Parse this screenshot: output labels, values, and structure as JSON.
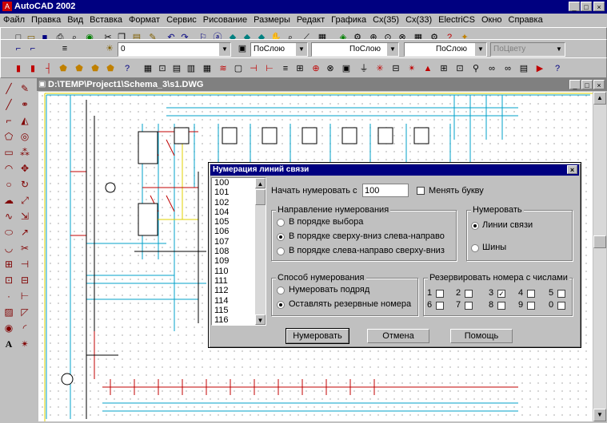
{
  "app": {
    "title": "AutoCAD 2002"
  },
  "menu": [
    "Файл",
    "Правка",
    "Вид",
    "Вставка",
    "Формат",
    "Сервис",
    "Рисование",
    "Размеры",
    "Редакт",
    "Графика",
    "Сх(35)",
    "Сх(33)",
    "ElectriCS",
    "Окно",
    "Справка"
  ],
  "toolbar2": {
    "layer": "0",
    "color": "ПоСлою",
    "linetype": "ПоСлою",
    "lineweight": "ПоСлою",
    "plotstyle": "ПоЦвету"
  },
  "drawing": {
    "title": "D:\\TEMP\\Project1\\Schema_3\\s1.DWG"
  },
  "dialog": {
    "title": "Нумерация линий связи",
    "list": [
      "100",
      "101",
      "102",
      "104",
      "105",
      "106",
      "107",
      "108",
      "109",
      "110",
      "111",
      "112",
      "114",
      "115",
      "116"
    ],
    "start_label": "Начать нумеровать с",
    "start_value": "100",
    "change_letter": "Менять букву",
    "direction": {
      "title": "Направление нумерования",
      "options": [
        "В порядке выбора",
        "В порядке сверху-вниз слева-направо",
        "В порядке слева-направо сверху-вниз"
      ],
      "selected": 1
    },
    "numerate": {
      "title": "Нумеровать",
      "options": [
        "Линии связи",
        "Шины"
      ],
      "selected": 0
    },
    "method": {
      "title": "Способ нумерования",
      "options": [
        "Нумеровать подряд",
        "Оставлять резервные номера"
      ],
      "selected": 1
    },
    "reserve": {
      "title": "Резервировать номера с числами",
      "digits": [
        "1",
        "2",
        "3",
        "4",
        "5",
        "6",
        "7",
        "8",
        "9",
        "0"
      ],
      "checked": [
        "3"
      ]
    },
    "buttons": {
      "ok": "Нумеровать",
      "cancel": "Отмена",
      "help": "Помощь"
    }
  }
}
